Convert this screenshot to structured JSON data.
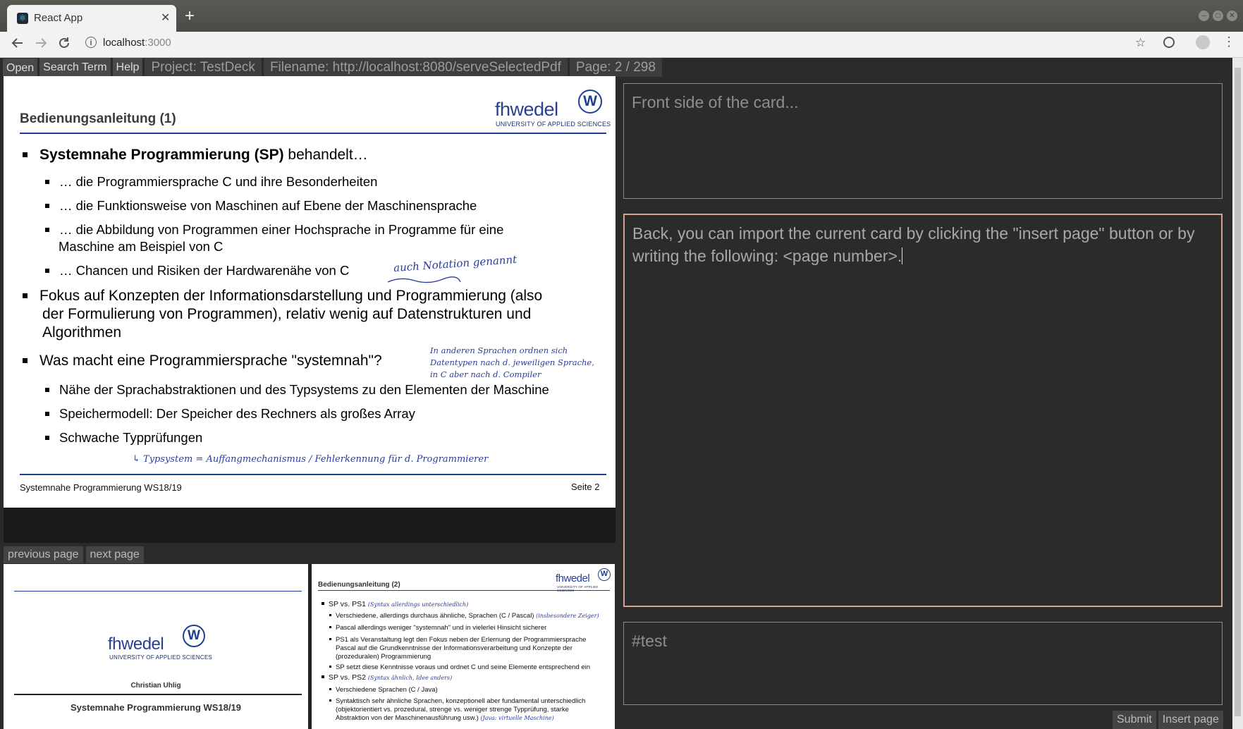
{
  "browser": {
    "tab_title": "React App",
    "tab_close": "✕",
    "new_tab": "+",
    "url_host": "localhost",
    "url_port": ":3000",
    "win_min": "–",
    "win_max": "□",
    "win_close": "✕"
  },
  "menu": {
    "open": "Open",
    "search_term": "Search Term",
    "help": "Help",
    "project": "Project: TestDeck",
    "filename": "Filename: http://localhost:8080/serveSelectedPdf",
    "page": "Page: 2 / 298"
  },
  "slide": {
    "title": "Bedienungsanleitung (1)",
    "logo_text": "fhwedel",
    "logo_sub": "UNIVERSITY OF APPLIED SCIENCES",
    "logo_letter": "W",
    "b1_bold": "Systemnahe Programmierung (SP)",
    "b1_rest": " behandelt…",
    "b1_sub1": "… die Programmiersprache C und ihre Besonderheiten",
    "b1_sub2": "… die Funktionsweise von Maschinen auf Ebene der Maschinensprache",
    "b1_sub3a": "… die Abbildung von Programmen einer Hochsprache in Programme für eine",
    "b1_sub3b": "Maschine am Beispiel von C",
    "b1_sub4": "… Chancen und Risiken der Hardwarenähe von C",
    "hw1": "auch Notation genannt",
    "b2a": "Fokus auf Konzepten der Informationsdarstellung und Programmierung (also",
    "b2b": "der Formulierung von Programmen), relativ wenig auf Datenstrukturen und",
    "b2c": "Algorithmen",
    "b3": "Was macht eine Programmiersprache \"systemnah\"?",
    "hw2a": "In anderen Sprachen ordnen sich",
    "hw2b": "Datentypen nach d. jeweiligen Sprache,",
    "hw2c": "in C aber nach d. Compiler",
    "b3_sub1": "Nähe der Sprachabstraktionen und des Typsystems zu den Elementen der Maschine",
    "b3_sub2": "Speichermodell: Der Speicher des Rechners als großes Array",
    "b3_sub3": "Schwache Typprüfungen",
    "hw3": "↳ Typsystem = Auffangmechanismus / Fehlerkennung für d. Programmierer",
    "footer_left": "Systemnahe Programmierung WS18/19",
    "footer_right": "Seite 2"
  },
  "nav": {
    "previous": "previous page",
    "next": "next page"
  },
  "thumb1": {
    "logo_text": "fhwedel",
    "logo_sub": "UNIVERSITY OF APPLIED SCIENCES",
    "logo_letter": "W",
    "author": "Christian Uhlig",
    "course": "Systemnahe Programmierung WS18/19"
  },
  "thumb2": {
    "title": "Bedienungsanleitung (2)",
    "logo_text": "fhwedel",
    "logo_sub": "UNIVERSITY OF APPLIED SCIENCES",
    "logo_letter": "W",
    "l1": "SP vs. PS1",
    "l1_hw": "(Syntax allerdings unterschiedlich)",
    "l2": "Verschiedene, allerdings durchaus ähnliche, Sprachen (C / Pascal)",
    "l2_hw": "(insbesondere Zeiger)",
    "l3": "Pascal allerdings weniger \"systemnah\" und in vielerlei Hinsicht sicherer",
    "l4a": "PS1 als Veranstaltung legt den Fokus neben der Erlernung der Programmiersprache",
    "l4b": "Pascal auf die Grundkenntnisse der Informationsverarbeitung und Konzepte der",
    "l4c": "(prozeduralen) Programmierung",
    "l5": "SP setzt diese Kenntnisse voraus und ordnet C und seine Elemente entsprechend ein",
    "l6": "SP vs. PS2",
    "l6_hw": "(Syntax ähnlich, Idee anders)",
    "l7": "Verschiedene Sprachen (C / Java)",
    "l8a": "Syntaktisch sehr ähnliche Sprachen, konzeptionell aber fundamental unterschiedlich",
    "l8b": "(objektorientiert vs. prozedural, strenge vs. weniger strenge Typprüfung, starke",
    "l8c": "Abstraktion von der Maschinenausführung usw.)",
    "l8_hw": "(Java: virtuelle Maschine)"
  },
  "cards": {
    "front_placeholder": "Front side of the card...",
    "back_text": "Back, you can import the current card by clicking the \"insert page\" button or by writing the following: <page number>.",
    "tags_placeholder": "#test"
  },
  "actions": {
    "submit": "Submit",
    "insert_page": "Insert page"
  },
  "colors": {
    "slide_blue": "#1c3f93",
    "back_card_border": "#d4a58e"
  }
}
